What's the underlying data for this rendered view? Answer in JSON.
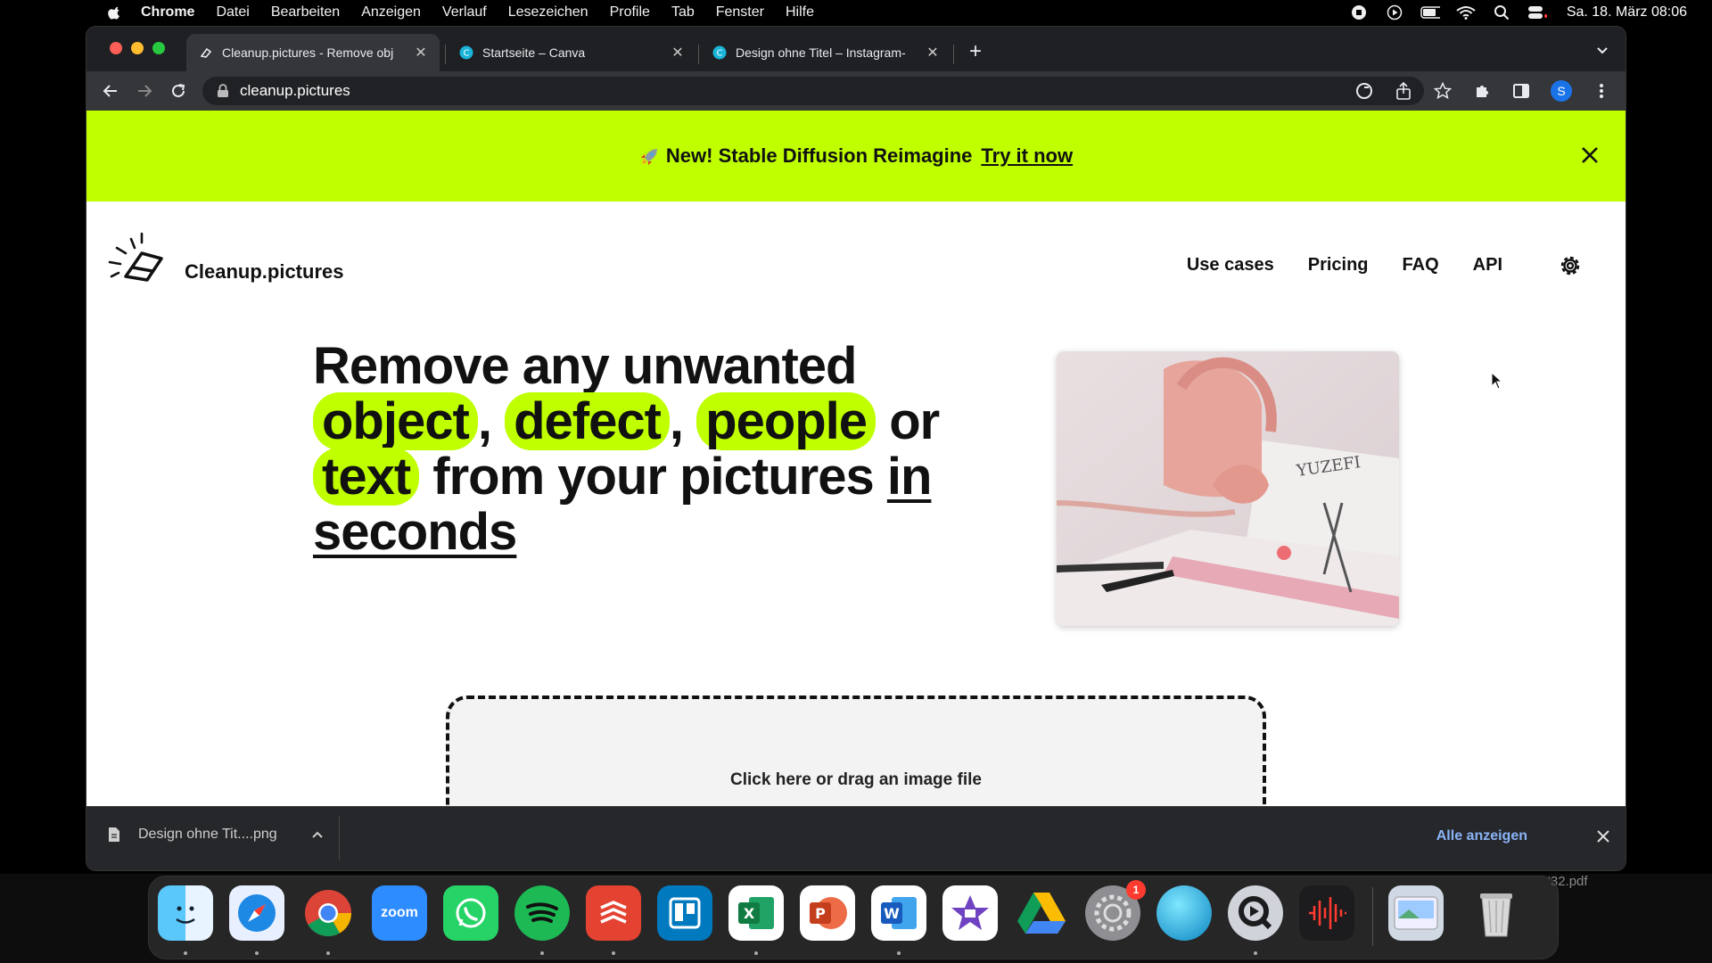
{
  "menubar": {
    "app_name": "Chrome",
    "items": [
      "Datei",
      "Bearbeiten",
      "Anzeigen",
      "Verlauf",
      "Lesezeichen",
      "Profile",
      "Tab",
      "Fenster",
      "Hilfe"
    ],
    "clock": "Sa. 18. März 08:06"
  },
  "tabs": [
    {
      "title": "Cleanup.pictures - Remove obj",
      "active": true
    },
    {
      "title": "Startseite – Canva",
      "active": false
    },
    {
      "title": "Design ohne Titel – Instagram-",
      "active": false
    }
  ],
  "toolbar": {
    "url": "cleanup.pictures",
    "profile_initial": "S"
  },
  "banner": {
    "text": "New! Stable Diffusion Reimagine",
    "link": "Try it now"
  },
  "site": {
    "brand": "Cleanup.pictures",
    "nav": [
      "Use cases",
      "Pricing",
      "FAQ",
      "API"
    ]
  },
  "hero": {
    "line1": "Remove any unwanted",
    "w_object": "object",
    "w_defect": "defect",
    "w_people": "people",
    "comma": ",",
    "or": "or",
    "w_text": "text",
    "line3_rest": "from your pictures",
    "in": "in",
    "seconds": "seconds"
  },
  "dropzone": {
    "label": "Click here or drag an image file"
  },
  "downloads": {
    "file": "Design ohne Tit....png",
    "show_all": "Alle anzeigen"
  },
  "dock": {
    "zoom_label": "zoom",
    "badge": "1"
  },
  "desktop": {
    "file_fragment": "'32.pdf"
  },
  "colors": {
    "accent": "#bfff00"
  }
}
